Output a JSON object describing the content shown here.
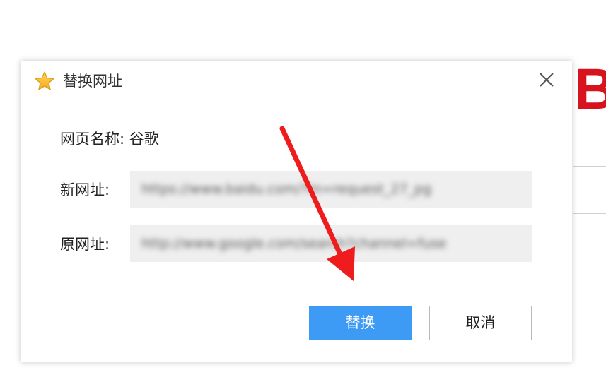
{
  "background": {
    "logo_fragment": "B",
    "logo_color": "#d7141d"
  },
  "dialog": {
    "title": "替换网址",
    "title_icon": "star-icon",
    "close_icon": "close-icon",
    "page_name_label": "网页名称:",
    "page_name_value": "谷歌",
    "new_url_label": "新网址:",
    "new_url_value": "https://www.baidu.com/?tn=request_27_pg",
    "old_url_label": "原网址:",
    "old_url_value": "http://www.google.com/search?channel=fuse",
    "replace_button": "替换",
    "cancel_button": "取消",
    "primary_color": "#3d9bf5"
  },
  "annotation": {
    "arrow_color": "#ee1c1c"
  }
}
